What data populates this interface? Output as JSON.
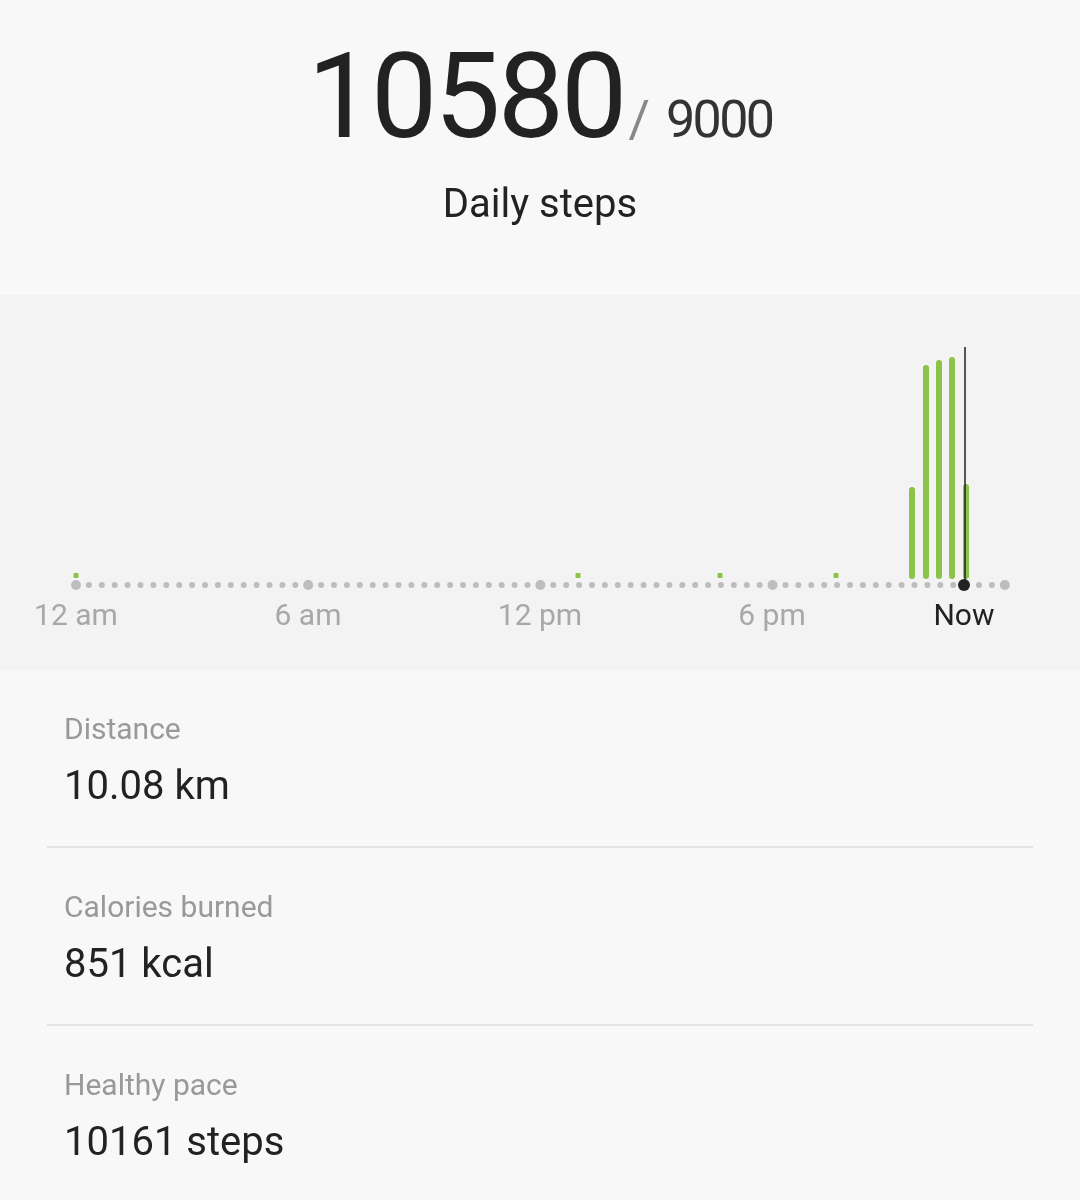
{
  "summary": {
    "steps": "10580",
    "separator": "/",
    "goal": "9000",
    "label": "Daily steps"
  },
  "chart": {
    "axis_labels": [
      {
        "text": "12 am",
        "current": false
      },
      {
        "text": "6 am",
        "current": false
      },
      {
        "text": "12 pm",
        "current": false
      },
      {
        "text": "6 pm",
        "current": false
      },
      {
        "text": "Now",
        "current": true
      }
    ]
  },
  "stats": [
    {
      "label": "Distance",
      "value": "10.08 km"
    },
    {
      "label": "Calories burned",
      "value": "851 kcal"
    },
    {
      "label": "Healthy pace",
      "value": "10161 steps"
    }
  ]
}
